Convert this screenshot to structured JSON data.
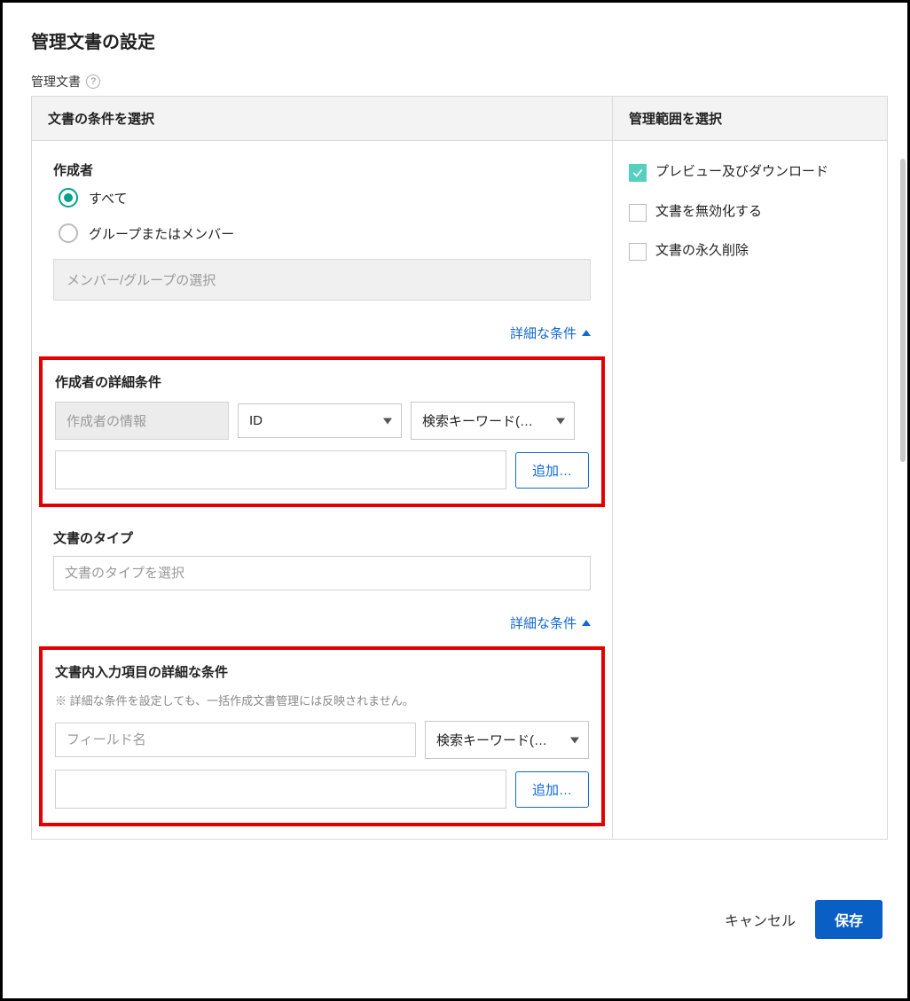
{
  "page_title": "管理文書の設定",
  "section_label": "管理文書",
  "left_header": "文書の条件を選択",
  "right_header": "管理範囲を選択",
  "creator": {
    "title": "作成者",
    "options": {
      "all": "すべて",
      "group": "グループまたはメンバー"
    },
    "member_placeholder": "メンバー/グループの選択"
  },
  "adv_link": "詳細な条件",
  "creator_adv": {
    "title": "作成者の詳細条件",
    "info_placeholder": "作成者の情報",
    "field1": "ID",
    "field2": "検索キーワード(…",
    "add": "追加…"
  },
  "doc_type": {
    "title": "文書のタイプ",
    "placeholder": "文書のタイプを選択"
  },
  "input_adv": {
    "title": "文書内入力項目の詳細な条件",
    "note": "※ 詳細な条件を設定しても、一括作成文書管理には反映されません。",
    "field_name_placeholder": "フィールド名",
    "keyword_placeholder": "検索キーワード(…",
    "add": "追加…"
  },
  "scope": {
    "preview": "プレビュー及びダウンロード",
    "disable": "文書を無効化する",
    "delete": "文書の永久削除"
  },
  "footer": {
    "cancel": "キャンセル",
    "save": "保存"
  }
}
